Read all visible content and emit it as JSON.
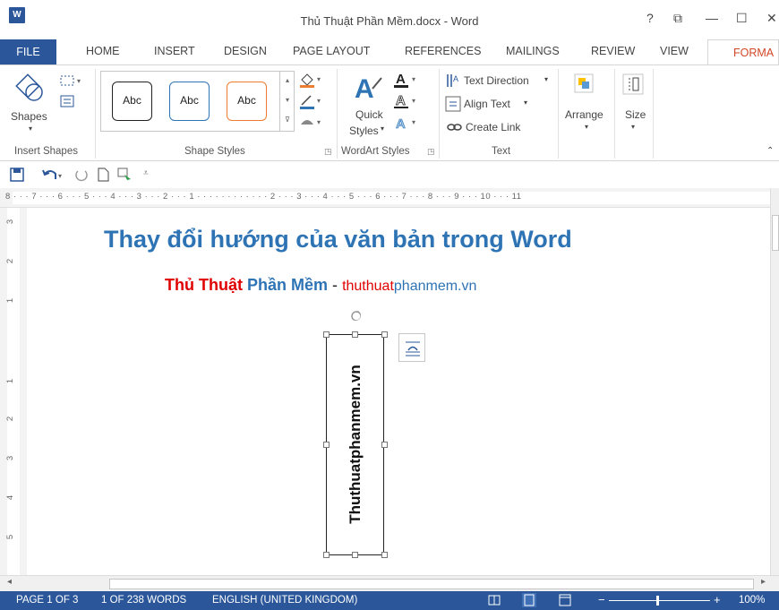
{
  "window": {
    "title": "Thủ Thuật Phần Mềm.docx - Word",
    "app_icon": "W",
    "help": "?",
    "restore": "⧉",
    "minimize": "—",
    "maximize": "☐",
    "close": "✕"
  },
  "tabs": [
    "FILE",
    "HOME",
    "INSERT",
    "DESIGN",
    "PAGE LAYOUT",
    "REFERENCES",
    "MAILINGS",
    "REVIEW",
    "VIEW",
    "FORMA"
  ],
  "ribbon": {
    "shapes_label": "Shapes",
    "insert_shapes_label": "Insert Shapes",
    "style_samples": [
      "Abc",
      "Abc",
      "Abc"
    ],
    "shape_styles_label": "Shape Styles",
    "quick_styles": "Quick",
    "quick_styles_2": "Styles",
    "wordart_label": "WordArt Styles",
    "text_direction": "Text Direction",
    "align_text": "Align Text",
    "create_link": "Create Link",
    "text_label": "Text",
    "arrange": "Arrange",
    "size": "Size"
  },
  "ruler": {
    "horizontal": "8 · · · 7 · · · 6 · · · 5 · · · 4 · · · 3 · · · 2 · · · 1 · · ·  · · · · · ·  · · · 2 · · · 3 · · · 4 · · · 5 · · · 6 · · · 7 · · · 8 · · · 9 · · · 10 · · · 11",
    "vertical": [
      "3",
      "2",
      "1",
      "1",
      "2",
      "3",
      "4",
      "5"
    ]
  },
  "document": {
    "title": "Thay đổi hướng của văn bản trong Word",
    "subtitle_part1": "Thủ Thuật",
    "subtitle_part2": "Phần Mềm",
    "subtitle_dash": "-",
    "url_part1": "thuthuat",
    "url_part2": "phanmem.vn",
    "textbox_text": "Thuthuatphanmem.vn"
  },
  "status": {
    "page": "PAGE 1 OF 3",
    "words": "1 OF 238 WORDS",
    "language": "ENGLISH (UNITED KINGDOM)",
    "zoom": "100%"
  },
  "colors": {
    "word_blue": "#2b579a",
    "format_tab": "#d24726",
    "doc_title": "#2e74b5",
    "red": "#e00000"
  }
}
